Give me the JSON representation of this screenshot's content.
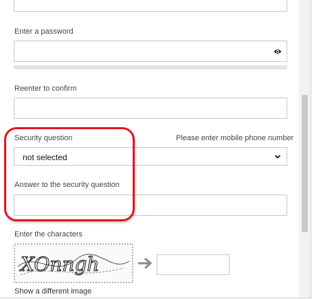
{
  "form": {
    "password_label": "Enter a password",
    "confirm_label": "Reenter to confirm",
    "security_question_label": "Security question",
    "phone_link": "Please enter mobile phone number",
    "security_question_value": "not selected",
    "answer_label": "Answer to the security question",
    "captcha_label": "Enter the characters",
    "captcha_text": "XOnngh",
    "show_different_image": "Show a different image"
  },
  "colors": {
    "highlight": "#e2141f",
    "border": "#c8c8c8"
  },
  "icons": {
    "eye": "eye-icon",
    "chevron": "chevron-down-icon",
    "arrow": "arrow-right-icon"
  }
}
